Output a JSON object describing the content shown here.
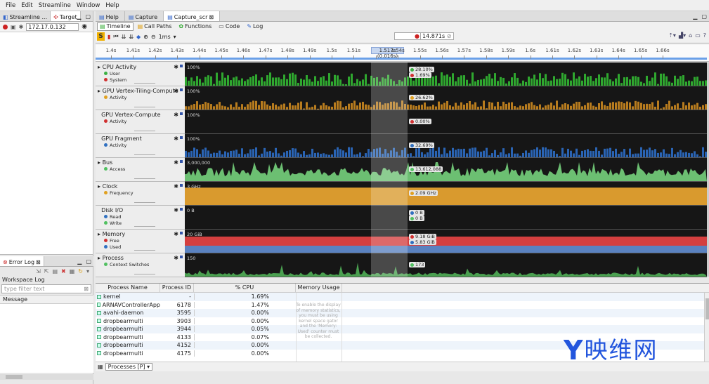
{
  "menu": [
    "File",
    "Edit",
    "Streamline",
    "Window",
    "Help"
  ],
  "left_tabs": {
    "streamline": "Streamline ...",
    "target": "Target"
  },
  "target": {
    "ip": "172.17.0.132"
  },
  "error_log": {
    "tab": "Error Log",
    "workspace_label": "Workspace Log",
    "filter_placeholder": "type filter text",
    "message_header": "Message"
  },
  "right_tabs": {
    "help": "Help",
    "capture": "Capture",
    "capture_scr": "Capture_scr"
  },
  "view_tabs": [
    "Timeline",
    "Call Paths",
    "Functions",
    "Code",
    "Log"
  ],
  "toolbar": {
    "zoom": "1ms",
    "time_value": "14.871s"
  },
  "ruler": {
    "ticks": [
      "1.4s",
      "1.41s",
      "1.42s",
      "1.43s",
      "1.44s",
      "1.45s",
      "1.46s",
      "1.47s",
      "1.48s",
      "1.49s",
      "1.5s",
      "1.51s",
      "",
      "1.54s",
      "1.55s",
      "1.56s",
      "1.57s",
      "1.58s",
      "1.59s",
      "1.6s",
      "1.61s",
      "1.62s",
      "1.63s",
      "1.64s",
      "1.65s",
      "1.66s"
    ],
    "selection": "1.517s (0.016s)"
  },
  "charts": [
    {
      "title": "CPU Activity",
      "series": [
        {
          "name": "User",
          "color": "#3cb043"
        },
        {
          "name": "System",
          "color": "#d03030"
        }
      ],
      "max": "100%",
      "readouts": [
        {
          "text": "28.10%",
          "color": "#3cb043"
        },
        {
          "text": "1.69%",
          "color": "#d03030"
        }
      ],
      "style": "bars",
      "fill": "#2fa82f",
      "level": 0.6
    },
    {
      "title": "GPU Vertex-Tiling-Compute",
      "series": [
        {
          "name": "Activity",
          "color": "#e0a020"
        }
      ],
      "max": "100%",
      "readouts": [
        {
          "text": "26.62%",
          "color": "#e0a020"
        }
      ],
      "style": "bars",
      "fill": "#b87c1e",
      "level": 0.4
    },
    {
      "title": "GPU Vertex-Compute",
      "series": [
        {
          "name": "Activity",
          "color": "#d03030"
        }
      ],
      "max": "100%",
      "readouts": [
        {
          "text": "0.00%",
          "color": "#d03030"
        }
      ],
      "style": "empty",
      "fill": "#222",
      "level": 0
    },
    {
      "title": "GPU Fragment",
      "series": [
        {
          "name": "Activity",
          "color": "#3070c0"
        }
      ],
      "max": "100%",
      "readouts": [
        {
          "text": "32.69%",
          "color": "#3070c0"
        }
      ],
      "style": "bars",
      "fill": "#2a64b4",
      "level": 0.45
    },
    {
      "title": "Bus",
      "series": [
        {
          "name": "Access",
          "color": "#50c060"
        }
      ],
      "max": "3,000,000",
      "readouts": [
        {
          "text": "13,612,088",
          "color": "#50c060"
        }
      ],
      "style": "area",
      "fill": "#6cbf72",
      "level": 0.5
    },
    {
      "title": "Clock",
      "series": [
        {
          "name": "Frequency",
          "color": "#e0a020"
        }
      ],
      "max": "3 GHz",
      "readouts": [
        {
          "text": "2.09 GHz",
          "color": "#e0a020"
        }
      ],
      "style": "solid",
      "fill": "#d99a2e",
      "level": 0.75
    },
    {
      "title": "Disk I/O",
      "series": [
        {
          "name": "Read",
          "color": "#3070c0"
        },
        {
          "name": "Write",
          "color": "#50c060"
        }
      ],
      "max": "0 B",
      "readouts": [
        {
          "text": "0 B",
          "color": "#3070c0"
        },
        {
          "text": "0 B",
          "color": "#50c060"
        }
      ],
      "style": "empty",
      "fill": "#222",
      "level": 0
    },
    {
      "title": "Memory",
      "series": [
        {
          "name": "Free",
          "color": "#d03030"
        },
        {
          "name": "Used",
          "color": "#3070c0"
        }
      ],
      "max": "20 GiB",
      "readouts": [
        {
          "text": "9.18 GiB",
          "color": "#d03030"
        },
        {
          "text": "5.83 GiB",
          "color": "#3070c0"
        }
      ],
      "style": "memory",
      "fill": "#d43f3f",
      "level": 0
    },
    {
      "title": "Process",
      "series": [
        {
          "name": "Context Switches",
          "color": "#50c060"
        }
      ],
      "max": "150",
      "readouts": [
        {
          "text": "173",
          "color": "#50c060"
        }
      ],
      "style": "area",
      "fill": "#4aa050",
      "level": 0.15
    }
  ],
  "table": {
    "headers": [
      "Process Name",
      "Process ID",
      "% CPU",
      "Memory Usage"
    ],
    "rows": [
      {
        "name": "kernel",
        "pid": "-",
        "cpu": "1.69%"
      },
      {
        "name": "ARNAVControllerApp",
        "pid": "6178",
        "cpu": "1.47%"
      },
      {
        "name": "avahi-daemon",
        "pid": "3595",
        "cpu": "0.00%"
      },
      {
        "name": "dropbearmulti",
        "pid": "3903",
        "cpu": "0.00%"
      },
      {
        "name": "dropbearmulti",
        "pid": "3944",
        "cpu": "0.05%"
      },
      {
        "name": "dropbearmulti",
        "pid": "4133",
        "cpu": "0.07%"
      },
      {
        "name": "dropbearmulti",
        "pid": "4152",
        "cpu": "0.00%"
      },
      {
        "name": "dropbearmulti",
        "pid": "4175",
        "cpu": "0.00%"
      }
    ],
    "memory_note": "To enable the display of memory statistics, you must be using kernel space gator and the 'Memory: Used' counter must be collected."
  },
  "bottom_tab": "Processes [P]",
  "watermark": {
    "logo": "Y",
    "text": "映维网"
  }
}
